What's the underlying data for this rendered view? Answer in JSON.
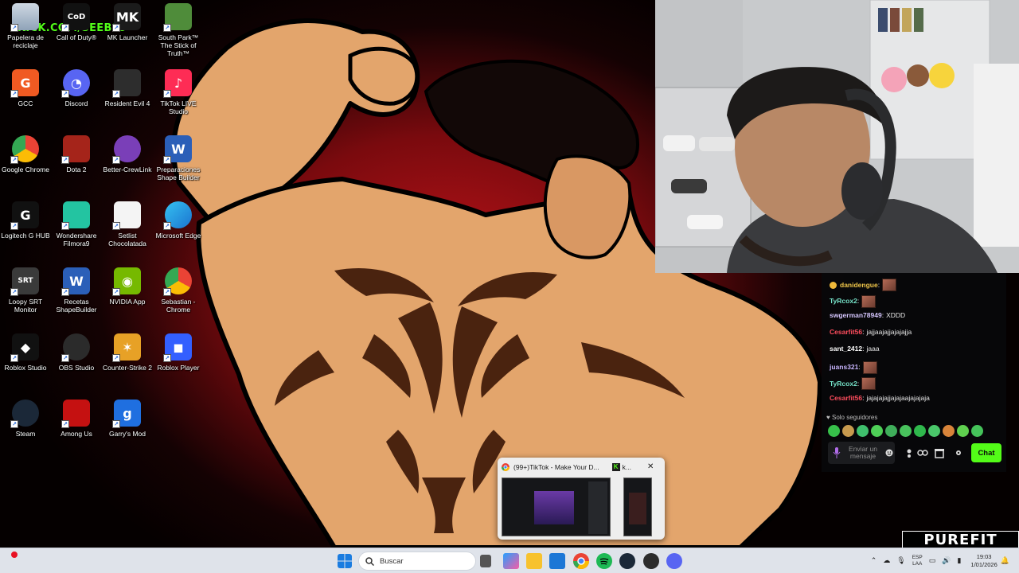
{
  "overlay": {
    "kick_url": "KICK.COM/SEEB99",
    "brand": "PUREFIT"
  },
  "desktop_icons": [
    {
      "label": "Papelera de reciclaje",
      "icon": "recycle-bin-icon"
    },
    {
      "label": "Call of Duty®",
      "icon": "call-of-duty-icon"
    },
    {
      "label": "MK Launcher",
      "icon": "mk-launcher-icon"
    },
    {
      "label": "South Park™ The Stick of Truth™",
      "icon": "south-park-icon"
    },
    {
      "label": "GCC",
      "icon": "gcc-icon"
    },
    {
      "label": "Discord",
      "icon": "discord-icon"
    },
    {
      "label": "Resident Evil 4",
      "icon": "resident-evil-icon"
    },
    {
      "label": "TikTok LIVE Studio",
      "icon": "tiktok-live-icon"
    },
    {
      "label": "Google Chrome",
      "icon": "chrome-icon"
    },
    {
      "label": "Dota 2",
      "icon": "dota2-icon"
    },
    {
      "label": "Better-CrewLink",
      "icon": "crewlink-icon"
    },
    {
      "label": "Preparaciones Shape Builder",
      "icon": "word-doc-icon"
    },
    {
      "label": "Logitech G HUB",
      "icon": "logitech-icon"
    },
    {
      "label": "Wondershare Filmora9",
      "icon": "filmora-icon"
    },
    {
      "label": "Setlist Chocolatada",
      "icon": "text-file-icon"
    },
    {
      "label": "Microsoft Edge",
      "icon": "edge-icon"
    },
    {
      "label": "Loopy SRT Monitor",
      "icon": "srt-icon"
    },
    {
      "label": "Recetas ShapeBuilder",
      "icon": "word-doc-icon"
    },
    {
      "label": "NVIDIA App",
      "icon": "nvidia-icon"
    },
    {
      "label": "Sebastian - Chrome",
      "icon": "chrome-profile-icon"
    },
    {
      "label": "Roblox Studio",
      "icon": "roblox-studio-icon"
    },
    {
      "label": "OBS Studio",
      "icon": "obs-icon"
    },
    {
      "label": "Counter-Strike 2",
      "icon": "cs2-icon"
    },
    {
      "label": "Roblox Player",
      "icon": "roblox-icon"
    },
    {
      "label": "Steam",
      "icon": "steam-icon"
    },
    {
      "label": "Among Us",
      "icon": "among-us-icon"
    },
    {
      "label": "Garry's Mod",
      "icon": "garrys-mod-icon"
    }
  ],
  "chat": {
    "messages": [
      {
        "user": "danidengue",
        "color": "#f0c64a",
        "text": "",
        "emote": true,
        "badge": true
      },
      {
        "user": "TyRcox2",
        "color": "#76e3c9",
        "text": "",
        "emote": true
      },
      {
        "user": "swgerman78949",
        "color": "#d6c7ff",
        "text": "XDDD",
        "emote": false
      },
      {
        "user": "Cesarfit56",
        "color": "#ff4d5d",
        "text": "jajjaajajjajajajja",
        "emote": false
      },
      {
        "user": "sant_2412",
        "color": "#ffffff",
        "text": "jaaa",
        "emote": false
      },
      {
        "user": "juans321",
        "color": "#c9b6ff",
        "text": "",
        "emote": true
      },
      {
        "user": "TyRcox2",
        "color": "#76e3c9",
        "text": "",
        "emote": true
      },
      {
        "user": "Cesarfit56",
        "color": "#ff4d5d",
        "text": "jajajajajjajajaajajajaja",
        "emote": false
      }
    ],
    "followers_only": "Solo seguidores",
    "input_placeholder": "Enviar un mensaje",
    "send_label": "Chat"
  },
  "taskbar_preview": {
    "title": "(99+)TikTok - Make Your D...",
    "second_title": "k..."
  },
  "taskbar": {
    "search_placeholder": "Buscar",
    "language_line1": "ESP",
    "language_line2": "LAA",
    "time": "19:03",
    "date": "1/01/2026"
  },
  "colors": {
    "kick_green": "#53fc18",
    "taskbar_bg": "#dfe3ea"
  }
}
